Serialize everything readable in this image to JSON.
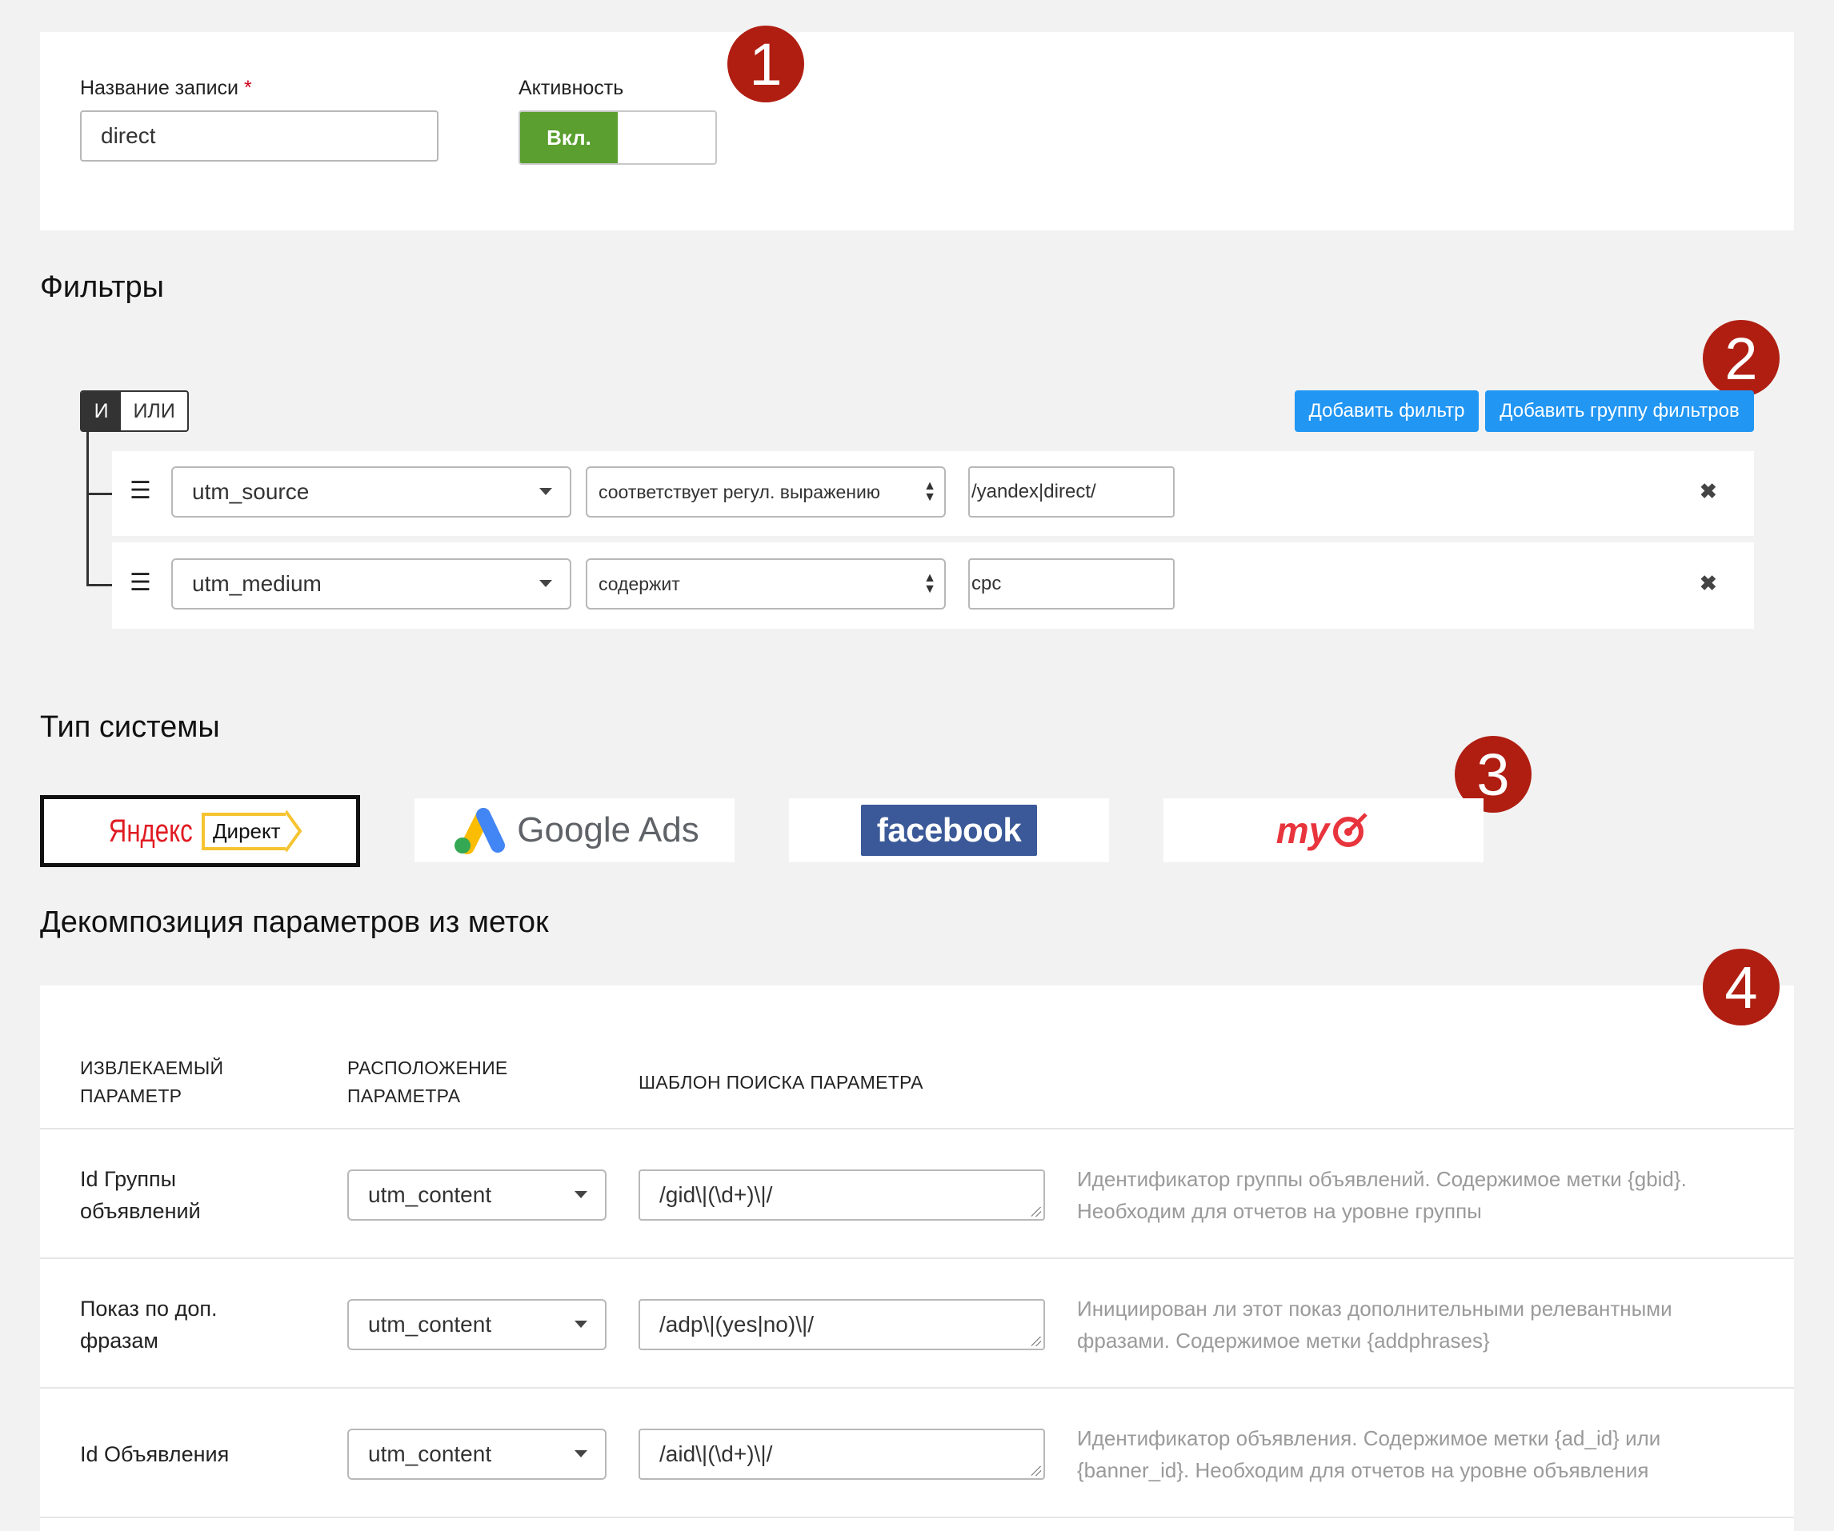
{
  "record": {
    "name_label": "Название записи",
    "required_mark": "*",
    "name_value": "direct",
    "activity_label": "Активность",
    "activity_on": "Вкл."
  },
  "markers": [
    "1",
    "2",
    "3",
    "4"
  ],
  "filters": {
    "title": "Фильтры",
    "logic_and": "И",
    "logic_or": "ИЛИ",
    "add_filter": "Добавить фильтр",
    "add_group": "Добавить группу фильтров",
    "rows": [
      {
        "field": "utm_source",
        "operator": "соответствует регул. выражению",
        "value": "/yandex|direct/"
      },
      {
        "field": "utm_medium",
        "operator": "содержит",
        "value": "cpc"
      }
    ]
  },
  "system_type": {
    "title": "Тип системы",
    "options": [
      {
        "yandex_word": "Яндекс",
        "yandex_tag": "Директ",
        "selected": true
      },
      {
        "text": "Google Ads"
      },
      {
        "text": "facebook"
      },
      {
        "text": "my"
      }
    ]
  },
  "decomposition": {
    "title": "Декомпозиция параметров из меток",
    "headers": {
      "param": [
        "ИЗВЛЕКАЕМЫЙ",
        "ПАРАМЕТР"
      ],
      "location": [
        "РАСПОЛОЖЕНИЕ",
        "ПАРАМЕТРА"
      ],
      "pattern": "ШАБЛОН ПОИСКА ПАРАМЕТРА"
    },
    "rows": [
      {
        "name": [
          "Id Группы",
          "объявлений"
        ],
        "location": "utm_content",
        "pattern": "/gid\\|(\\d+)\\|/",
        "desc": [
          "Идентификатор группы объявлений. Содержимое метки {gbid}.",
          "Необходим для отчетов на уровне группы"
        ]
      },
      {
        "name": [
          "Показ по доп.",
          "фразам"
        ],
        "location": "utm_content",
        "pattern": "/adp\\|(yes|no)\\|/",
        "desc": [
          "Инициирован ли этот показ дополнительными релевантными",
          "фразами. Содержимое метки {addphrases}"
        ]
      },
      {
        "name": [
          "Id Объявления"
        ],
        "location": "utm_content",
        "pattern": "/aid\\|(\\d+)\\|/",
        "desc": [
          "Идентификатор объявления. Содержимое метки {ad_id} или",
          "{banner_id}. Необходим для отчетов на уровне объявления"
        ]
      }
    ]
  },
  "colors": {
    "toggle_on": "#5a9f2f",
    "button": "#2196f3",
    "marker": "#b01e12"
  }
}
